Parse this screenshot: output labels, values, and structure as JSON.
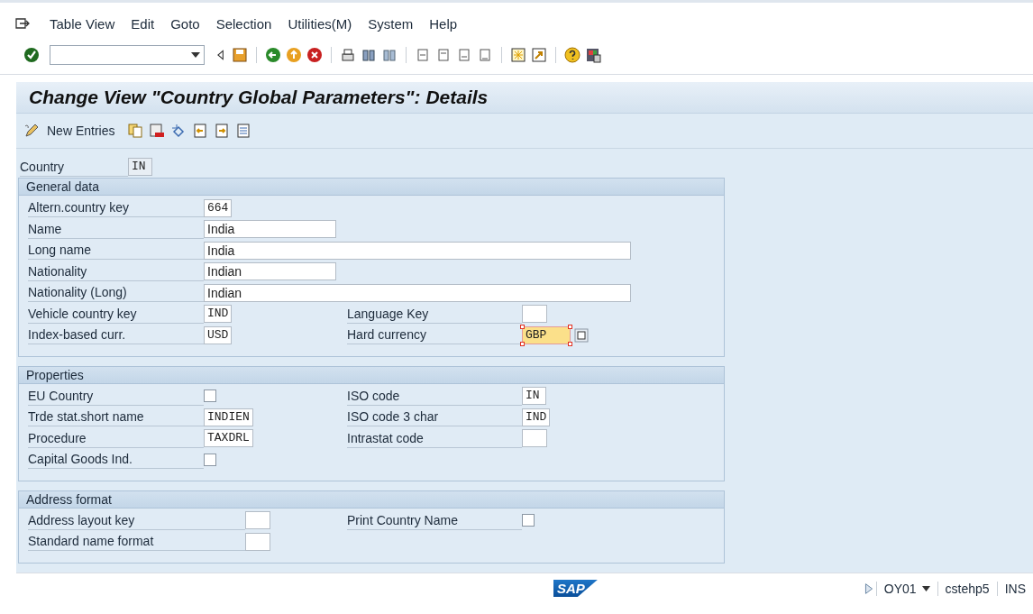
{
  "menu": [
    "Table View",
    "Edit",
    "Goto",
    "Selection",
    "Utilities(M)",
    "System",
    "Help"
  ],
  "title": "Change View \"Country Global Parameters\": Details",
  "app_toolbar": {
    "new_entries": "New Entries"
  },
  "key_field": {
    "label": "Country",
    "value": "IN"
  },
  "sections": [
    {
      "title": "General data",
      "rows": [
        [
          {
            "label": "Altern.country key",
            "kind": "code",
            "value": "664",
            "focused": false
          }
        ],
        [
          {
            "label": "Name",
            "kind": "text",
            "value": "India",
            "focused": false
          }
        ],
        [
          {
            "label": "Long name",
            "kind": "long",
            "value": "India",
            "focused": false
          }
        ],
        [
          {
            "label": "Nationality",
            "kind": "text",
            "value": "Indian",
            "focused": false
          }
        ],
        [
          {
            "label": "Nationality (Long)",
            "kind": "long",
            "value": "Indian",
            "focused": false
          }
        ],
        [
          {
            "label": "Vehicle country key",
            "kind": "code",
            "value": "IND",
            "focused": false
          },
          {
            "label": "Language Key",
            "kind": "code",
            "focused": false
          }
        ],
        [
          {
            "label": "Index-based curr.",
            "kind": "code",
            "value": "USD",
            "focused": false
          },
          {
            "label": "Hard currency",
            "kind": "code",
            "value": "GBP",
            "focused": true
          }
        ]
      ]
    },
    {
      "title": "Properties",
      "rows": [
        [
          {
            "label": "EU Country",
            "kind": "checkbox",
            "checked": false
          },
          {
            "label": "ISO code",
            "kind": "code",
            "value": "IN",
            "focused": false
          }
        ],
        [
          {
            "label": "Trde stat.short name",
            "kind": "code",
            "value": "INDIEN",
            "focused": false
          },
          {
            "label": "ISO code 3 char",
            "kind": "code",
            "value": "IND",
            "focused": false
          }
        ],
        [
          {
            "label": "Procedure",
            "kind": "code",
            "value": "TAXDRL",
            "focused": false
          },
          {
            "label": "Intrastat code",
            "kind": "code",
            "focused": false
          }
        ],
        [
          {
            "label": "Capital Goods Ind.",
            "kind": "checkbox",
            "checked": false
          }
        ]
      ]
    },
    {
      "title": "Address format",
      "rows": [
        [
          {
            "label": "Address layout key",
            "kind": "code",
            "focused": false
          },
          {
            "label": "Print Country Name",
            "kind": "checkbox",
            "checked": false
          }
        ],
        [
          {
            "label": "Standard name format",
            "kind": "code",
            "focused": false
          }
        ]
      ]
    }
  ],
  "status_bar": {
    "logo": "SAP",
    "transaction": "OY01",
    "system": "cstehp5",
    "mode": "INS"
  }
}
